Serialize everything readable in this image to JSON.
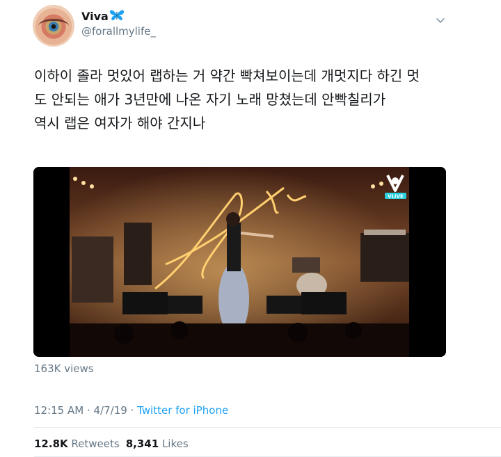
{
  "author": {
    "display_name": "Viva",
    "handle": "@forallmylife_"
  },
  "tweet": {
    "text": "이하이 졸라 멋있어 랩하는 거 약간 빡쳐보이는데 개멋지다 하긴 멋\n도 안되는 애가 3년만에 나온 자기 노래 망쳤는데 안빡칠리가\n역시 랩은 여자가 해야 간지나"
  },
  "video": {
    "channel_badge": "VLIVE"
  },
  "views": "163K views",
  "meta": {
    "time": "12:15 AM",
    "separator1": " · ",
    "date": "4/7/19",
    "separator2": " · ",
    "source": "Twitter for iPhone"
  },
  "stats": {
    "retweets_count": "12.8K",
    "retweets_label": "Retweets",
    "likes_count": "8,341",
    "likes_label": "Likes"
  },
  "colors": {
    "link": "#1da1f2",
    "secondary_text": "#657786",
    "primary_text": "#14171a",
    "verified_butterfly": "#1da1f2"
  },
  "icons": [
    "butterfly-icon",
    "chevron-down-icon",
    "vlive-logo-icon"
  ]
}
